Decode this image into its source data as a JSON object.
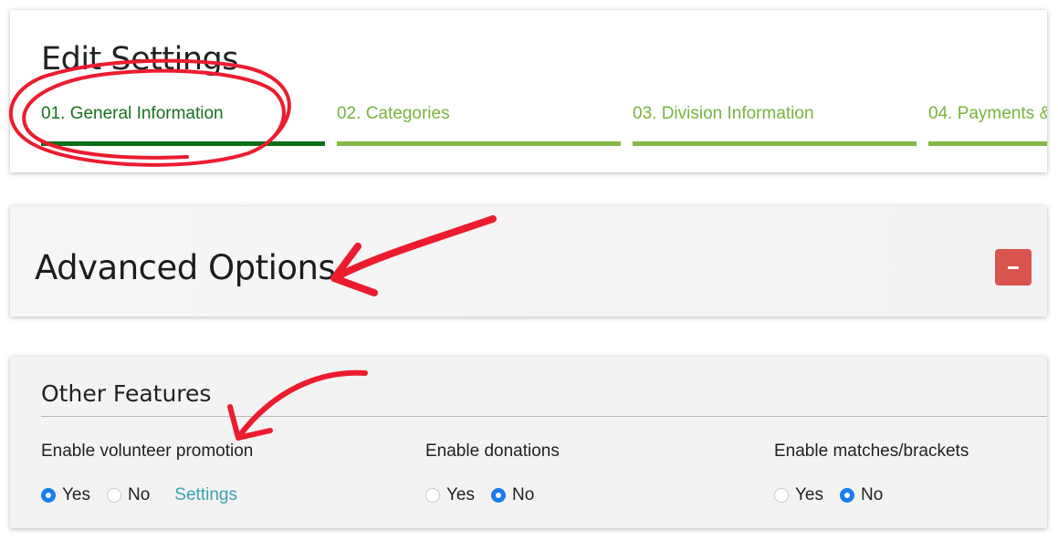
{
  "edit_settings": {
    "title": "Edit Settings",
    "steps": [
      {
        "label": "01. General Information",
        "active": true
      },
      {
        "label": "02. Categories",
        "active": false
      },
      {
        "label": "03. Division Information",
        "active": false
      },
      {
        "label": "04. Payments &",
        "active": false
      }
    ]
  },
  "advanced": {
    "title": "Advanced Options",
    "collapse_icon": "minus-icon"
  },
  "other_features": {
    "title": "Other Features",
    "features": [
      {
        "label": "Enable volunteer promotion",
        "yes_label": "Yes",
        "no_label": "No",
        "selected": "Yes",
        "link_label": "Settings"
      },
      {
        "label": "Enable donations",
        "yes_label": "Yes",
        "no_label": "No",
        "selected": "No"
      },
      {
        "label": "Enable matches/brackets",
        "yes_label": "Yes",
        "no_label": "No",
        "selected": "No"
      }
    ]
  },
  "colors": {
    "step_active": "#0b6e16",
    "step_inactive": "#84b845",
    "danger_button": "#d9534f",
    "radio_selected": "#1a7cf0",
    "link": "#3aa1b3",
    "annotation": "#ec1c2e"
  }
}
